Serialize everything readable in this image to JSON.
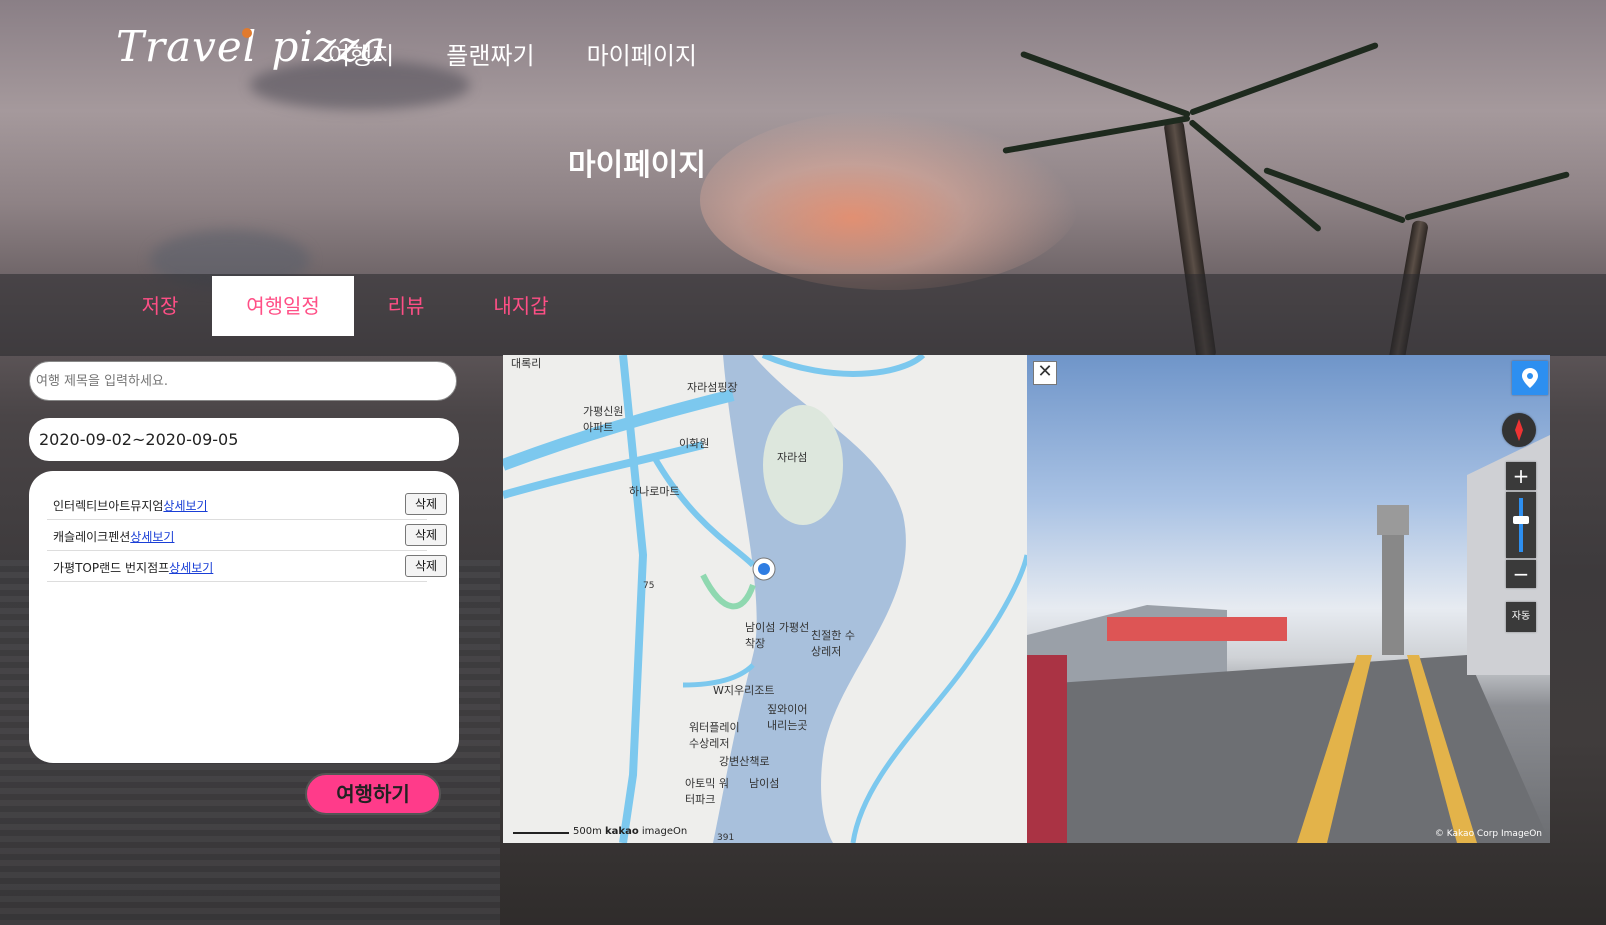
{
  "header": {
    "logo": "Travel pizza",
    "nav": [
      "여행지",
      "플랜짜기",
      "마이페이지"
    ]
  },
  "hero": {
    "title": "마이페이지"
  },
  "tabs": [
    {
      "label": "저장",
      "active": false
    },
    {
      "label": "여행일정",
      "active": true
    },
    {
      "label": "리뷰",
      "active": false
    },
    {
      "label": "내지갑",
      "active": false
    }
  ],
  "plan": {
    "title_placeholder": "여행 제목을 입력하세요.",
    "date_range": "2020-09-02~2020-09-05",
    "items": [
      {
        "name": "인터렉티브아트뮤지엄",
        "link": "상세보기",
        "delete": "삭제"
      },
      {
        "name": "캐슬레이크펜션",
        "link": "상세보기",
        "delete": "삭제"
      },
      {
        "name": "가평TOP랜드 번지점프",
        "link": "상세보기",
        "delete": "삭제"
      }
    ],
    "go_button": "여행하기"
  },
  "map": {
    "labels": [
      "대록리",
      "자라섬핑장",
      "가평신원아파트",
      "이화원",
      "자라섬",
      "하나로마트",
      "75",
      "남이섬 가평선착장",
      "친절한 수상레저",
      "W지우리조트",
      "짚와이어 내리는곳",
      "워터플레이 수상레저",
      "강변산책로",
      "아토믹 워터파크",
      "남이섬",
      "391"
    ],
    "scale": "500m",
    "attribution_brand": "kakao",
    "attribution_partner": "imageOn"
  },
  "roadview": {
    "close": "✕",
    "zoom_in": "+",
    "zoom_out": "−",
    "auto": "자동",
    "copyright": "© Kakao Corp",
    "partner": "ImageOn"
  },
  "colors": {
    "accent": "#ff4f86",
    "button": "#ff3b8a",
    "link": "#1a3fd6"
  },
  "icons": [
    "location-pin-icon",
    "compass-icon",
    "close-icon"
  ]
}
